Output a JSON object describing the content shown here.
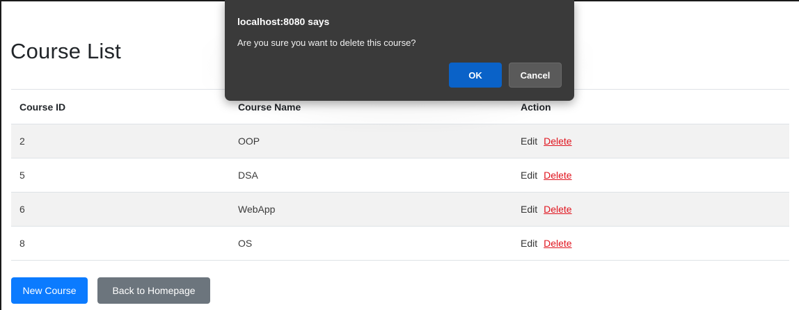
{
  "page": {
    "title": "Course List"
  },
  "table": {
    "headers": {
      "id": "Course ID",
      "name": "Course Name",
      "action": "Action"
    },
    "rows": [
      {
        "id": "2",
        "name": "OOP",
        "edit": "Edit",
        "delete": "Delete"
      },
      {
        "id": "5",
        "name": "DSA",
        "edit": "Edit",
        "delete": "Delete"
      },
      {
        "id": "6",
        "name": "WebApp",
        "edit": "Edit",
        "delete": "Delete"
      },
      {
        "id": "8",
        "name": "OS",
        "edit": "Edit",
        "delete": "Delete"
      }
    ]
  },
  "buttons": {
    "new_course": "New Course",
    "back_home": "Back to Homepage"
  },
  "dialog": {
    "title": "localhost:8080 says",
    "message": "Are you sure you want to delete this course?",
    "ok_label": "OK",
    "cancel_label": "Cancel"
  },
  "colors": {
    "primary": "#0b7bff",
    "secondary": "#6c757d",
    "danger_link": "#e0141e",
    "dialog_bg": "#3a3a3a",
    "dialog_ok": "#0a62c8"
  }
}
